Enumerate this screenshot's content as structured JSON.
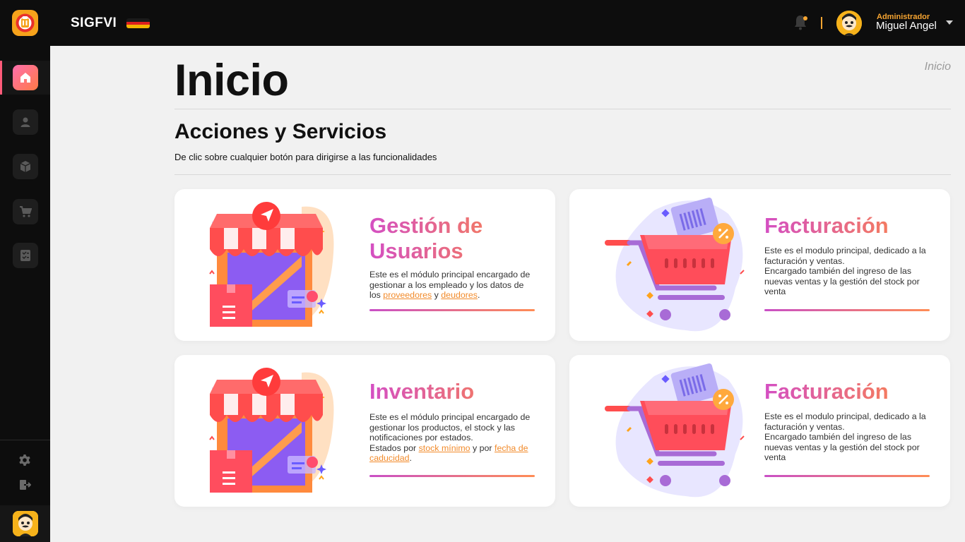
{
  "app": {
    "brand": "SIGFVI"
  },
  "user": {
    "role": "Administrador",
    "name": "Miguel Angel"
  },
  "sidebar": {
    "items": [
      {
        "name": "home",
        "icon": "home-icon",
        "active": true
      },
      {
        "name": "users",
        "icon": "user-icon",
        "active": false
      },
      {
        "name": "inventory",
        "icon": "box-icon",
        "active": false
      },
      {
        "name": "sales",
        "icon": "cart-icon",
        "active": false
      },
      {
        "name": "reports",
        "icon": "checklist-icon",
        "active": false
      }
    ],
    "bottom": [
      {
        "name": "settings",
        "icon": "gear-icon"
      },
      {
        "name": "logout",
        "icon": "logout-icon"
      }
    ]
  },
  "page": {
    "title": "Inicio",
    "breadcrumb": "Inicio",
    "section_title": "Acciones y Servicios",
    "section_subtitle": "De clic sobre cualquier botón para dirigirse a las funcionalidades"
  },
  "cards": [
    {
      "title": "Gestión de Usuarios",
      "illustration": "store-illustration",
      "desc_parts": [
        {
          "text": "Este es el módulo principal encargado de gestionar a los empleado y los datos de los "
        },
        {
          "link": "proveedores"
        },
        {
          "text": " y "
        },
        {
          "link": "deudores"
        },
        {
          "text": "."
        }
      ]
    },
    {
      "title": "Facturación",
      "illustration": "cart-illustration",
      "desc_lines": [
        "Este es el modulo principal, dedicado a la facturación y ventas.",
        "Encargado también del ingreso de las nuevas ventas y la gestión del stock por venta"
      ]
    },
    {
      "title": "Inventario",
      "illustration": "store-illustration",
      "desc_parts": [
        {
          "text": "Este es el módulo principal encargado de gestionar los productos, el stock y las notificaciones por estados."
        },
        {
          "break": true
        },
        {
          "text": "Estados por "
        },
        {
          "link": "stock mínimo"
        },
        {
          "text": " y por "
        },
        {
          "link": "fecha de caducidad"
        },
        {
          "text": "."
        }
      ]
    },
    {
      "title": "Facturación",
      "illustration": "cart-illustration",
      "desc_lines": [
        "Este es el modulo principal, dedicado a la facturación y ventas.",
        "Encargado también del ingreso de las nuevas ventas y la gestión del stock por venta"
      ]
    }
  ],
  "colors": {
    "accent_orange": "#f7a531",
    "gradient_start": "#d44fc3",
    "gradient_end": "#ff8a3d"
  }
}
